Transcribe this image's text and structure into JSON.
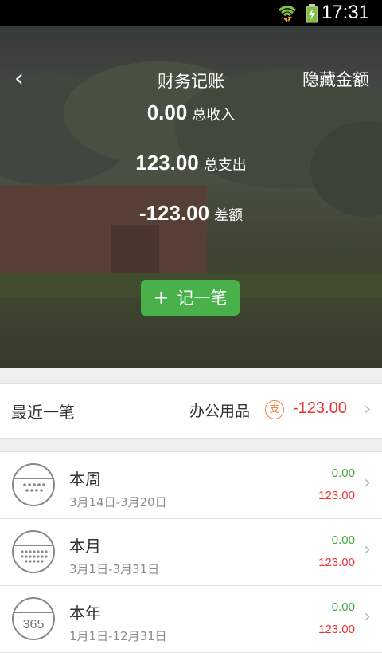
{
  "statusbar": {
    "time": "17:31"
  },
  "nav": {
    "back_icon": "‹",
    "title": "财务记账",
    "hide_label": "隐藏金额"
  },
  "summary": {
    "income": {
      "value": "0.00",
      "label": "总收入"
    },
    "expense": {
      "value": "123.00",
      "label": "总支出"
    },
    "diff": {
      "value": "-123.00",
      "label": "差额"
    }
  },
  "add_button": {
    "plus": "+",
    "label": "记一笔"
  },
  "recent": {
    "label": "最近一笔",
    "category": "办公用品",
    "badge": "支",
    "amount": "-123.00"
  },
  "periods": [
    {
      "title": "本周",
      "range": "3月14日-3月20日",
      "income": "0.00",
      "expense": "123.00",
      "icon_text": ""
    },
    {
      "title": "本月",
      "range": "3月1日-3月31日",
      "income": "0.00",
      "expense": "123.00",
      "icon_text": ""
    },
    {
      "title": "本年",
      "range": "1月1日-12月31日",
      "income": "0.00",
      "expense": "123.00",
      "icon_text": "365"
    }
  ],
  "colors": {
    "accent_green": "#49b14a",
    "income_green": "#3caa3c",
    "expense_red": "#e8332e",
    "badge_orange": "#f08040"
  }
}
